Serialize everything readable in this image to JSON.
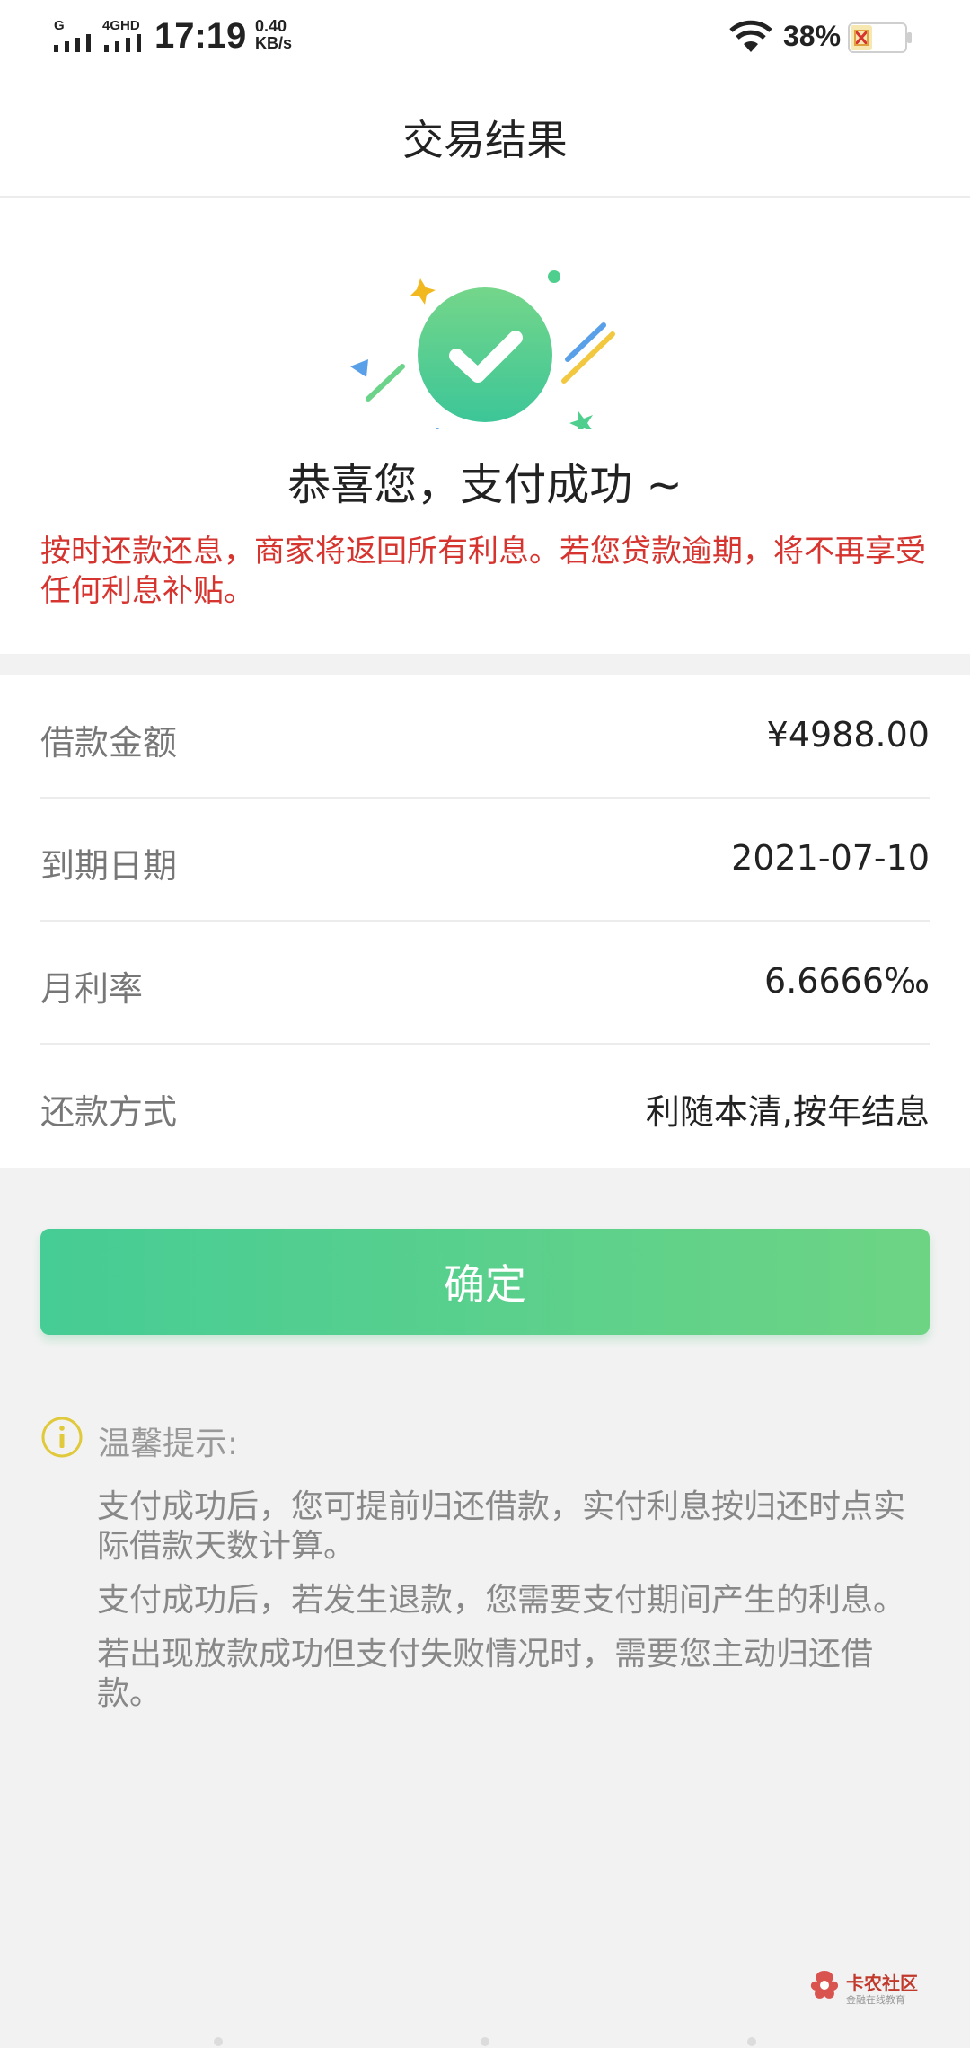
{
  "status_bar": {
    "network1": "G",
    "network2": "4GHD",
    "time": "17:19",
    "speed_value": "0.40",
    "speed_unit": "KB/s",
    "battery": "38%"
  },
  "navbar": {
    "title": "交易结果"
  },
  "success": {
    "title": "恭喜您，支付成功 ~",
    "notice": "按时还款还息，商家将返回所有利息。若您贷款逾期，将不再享受任何利息补贴。"
  },
  "details": [
    {
      "label": "借款金额",
      "value": "¥4988.00"
    },
    {
      "label": "到期日期",
      "value": "2021-07-10"
    },
    {
      "label": "月利率",
      "value": "6.6666‰"
    },
    {
      "label": "还款方式",
      "value": "利随本清,按年结息"
    }
  ],
  "confirm_button": "确定",
  "tips": {
    "title": "温馨提示:",
    "items": [
      "支付成功后，您可提前归还借款，实付利息按归还时点实际借款天数计算。",
      "支付成功后，若发生退款，您需要支付期间产生的利息。",
      "若出现放款成功但支付失败情况时，需要您主动归还借款。"
    ]
  },
  "watermark": {
    "name": "卡农社区",
    "sub": "金融在线教育"
  },
  "colors": {
    "accent_green": "#46cc95",
    "notice_red": "#d6342f",
    "tip_yellow": "#e0c93a"
  }
}
